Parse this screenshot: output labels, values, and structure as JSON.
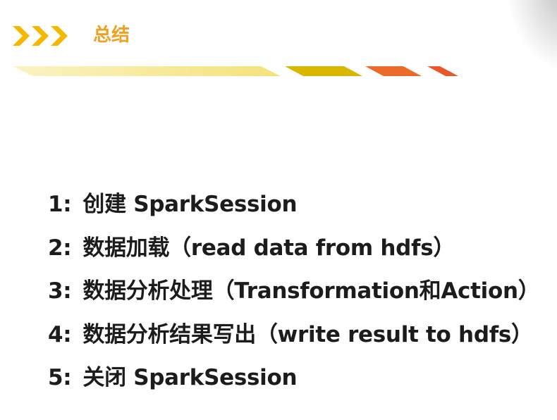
{
  "header": {
    "title": "总结",
    "accent_colors": {
      "chevron": "#f5b800",
      "title": "#f0a020",
      "stripe_yellow_light": "#f3e27a",
      "stripe_yellow": "#d9b700",
      "stripe_orange": "#ea6b2a",
      "stripe_red_orange": "#e8582c"
    }
  },
  "items": [
    {
      "num": "1:",
      "text": "创建 SparkSession"
    },
    {
      "num": "2:",
      "text": "数据加载（read data from hdfs）"
    },
    {
      "num": "3:",
      "text": "数据分析处理（Transformation和Action）"
    },
    {
      "num": "4:",
      "text": "数据分析结果写出（write result to hdfs）"
    },
    {
      "num": "5:",
      "text": "关闭 SparkSession"
    }
  ]
}
